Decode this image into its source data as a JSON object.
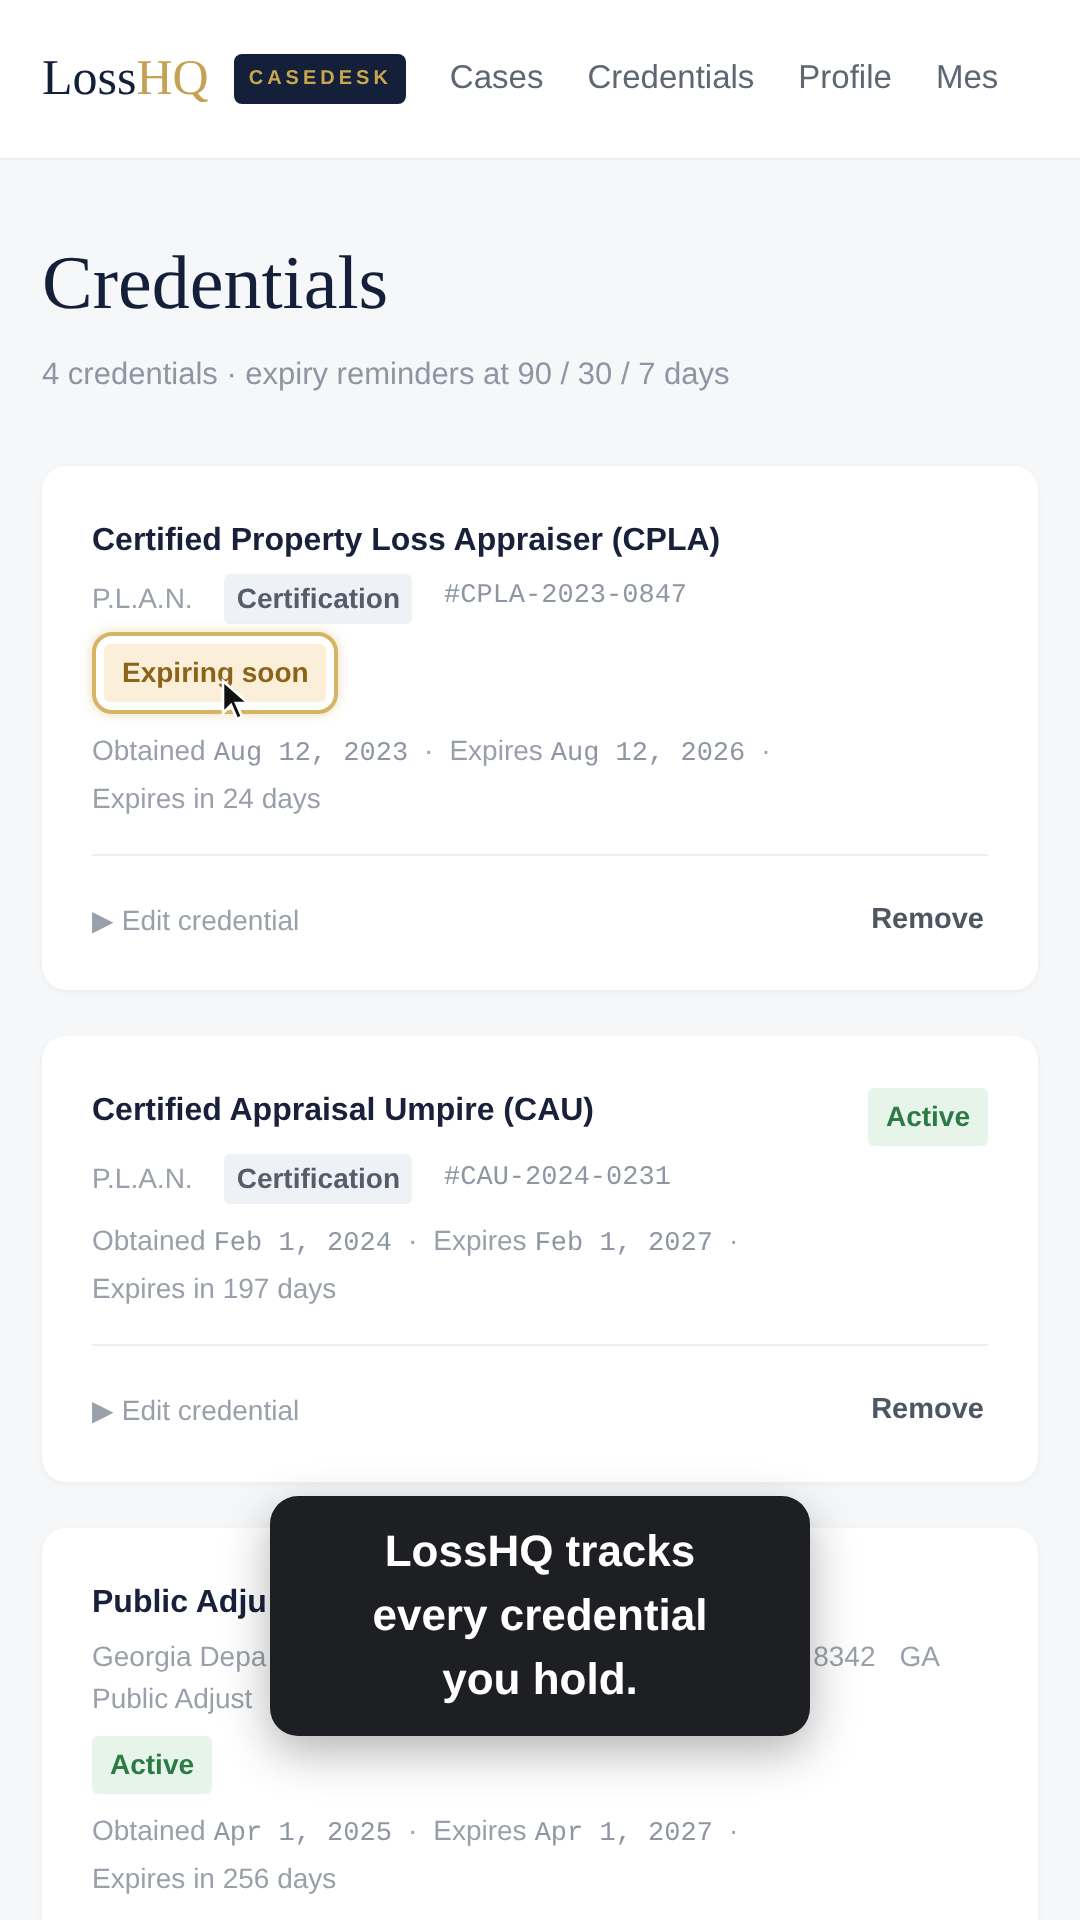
{
  "brand": {
    "name": "Loss",
    "accent": "HQ",
    "badge": "CASEDESK"
  },
  "nav": [
    {
      "label": "Cases",
      "selected": false
    },
    {
      "label": "Credentials",
      "selected": false
    },
    {
      "label": "Profile",
      "selected": false
    },
    {
      "label": "Mes",
      "selected": false
    }
  ],
  "page": {
    "title": "Credentials",
    "subtitle": "4 credentials · expiry reminders at 90 / 30 / 7 days"
  },
  "credentials": [
    {
      "title": "Certified Property Loss Appraiser (CPLA)",
      "issuer": "P.L.A.N.",
      "type": "Certification",
      "number": "#CPLA-2023-0847",
      "badge": {
        "label": "Expiring soon",
        "kind": "expiring",
        "highlighted": true
      },
      "obtained_label": "Obtained",
      "obtained": "Aug 12, 2023",
      "separator": "·",
      "expires_label": "Expires",
      "expires": "Aug 12, 2026",
      "separator_end": "·",
      "remaining": "Expires in 24 days",
      "edit": "▶ Edit credential",
      "remove": "Remove"
    },
    {
      "title": "Certified Appraisal Umpire (CAU)",
      "title_badge": {
        "label": "Active",
        "kind": "active",
        "highlighted": false
      },
      "issuer": "P.L.A.N.",
      "type": "Certification",
      "number": "#CAU-2024-0231",
      "obtained_label": "Obtained",
      "obtained": "Feb 1, 2024",
      "separator": "·",
      "expires_label": "Expires",
      "expires": "Feb 1, 2027",
      "separator_end": "·",
      "remaining": "Expires in 197 days",
      "edit": "▶ Edit credential",
      "remove": "Remove"
    },
    {
      "title": "Public Adju",
      "issuer": "Georgia Depa",
      "number": "8342",
      "region": "GA",
      "issuer_line2": "Public Adjust",
      "badge": {
        "label": "Active",
        "kind": "active",
        "highlighted": false
      },
      "obtained_label": "Obtained",
      "obtained": "Apr 1, 2025",
      "separator": "·",
      "expires_label": "Expires",
      "expires": "Apr 1, 2027",
      "separator_end": "·",
      "remaining": "Expires in 256 days"
    }
  ],
  "tooltip": {
    "text": "LossHQ tracks every credential you hold."
  }
}
